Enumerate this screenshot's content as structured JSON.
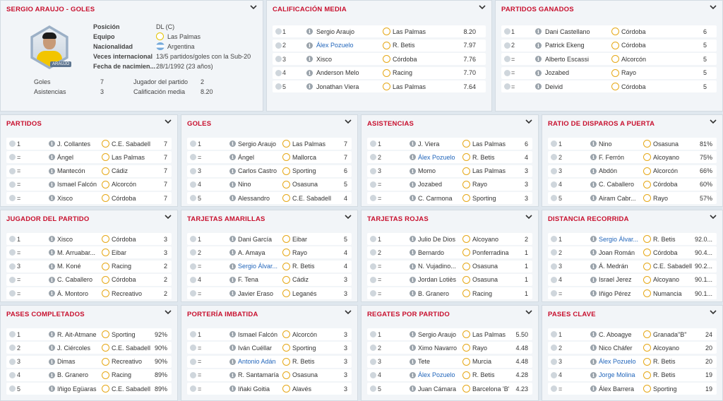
{
  "profile": {
    "title": "SERGIO ARAUJO - GOLES",
    "avatar_tag": "ARAUJO",
    "fields": [
      {
        "label": "Posición",
        "value": "DL (C)"
      },
      {
        "label": "Equipo",
        "value": "Las Palmas"
      },
      {
        "label": "Nacionalidad",
        "value": "Argentina"
      },
      {
        "label": "Veces internacional",
        "value": "13/5 partidos/goles con la Sub-20"
      },
      {
        "label": "Fecha de nacimien...",
        "value": "28/1/1992 (23 años)"
      }
    ],
    "stats": [
      {
        "label": "Goles",
        "value": "7"
      },
      {
        "label": "Asistencias",
        "value": "3"
      },
      {
        "label": "Jugador del partido",
        "value": "2"
      },
      {
        "label": "Calificación media",
        "value": "8.20"
      }
    ]
  },
  "calificacion": {
    "title": "CALIFICACIÓN MEDIA",
    "rows": [
      {
        "pos": "1",
        "name": "Sergio Araujo",
        "club": "Las Palmas",
        "value": "8.20",
        "hl": false
      },
      {
        "pos": "2",
        "name": "Álex Pozuelo",
        "club": "R. Betis",
        "value": "7.97",
        "hl": true
      },
      {
        "pos": "3",
        "name": "Xisco",
        "club": "Córdoba",
        "value": "7.76",
        "hl": false
      },
      {
        "pos": "4",
        "name": "Anderson Melo",
        "club": "Racing",
        "value": "7.70",
        "hl": false
      },
      {
        "pos": "5",
        "name": "Jonathan Viera",
        "club": "Las Palmas",
        "value": "7.64",
        "hl": false
      }
    ]
  },
  "ganados": {
    "title": "PARTIDOS GANADOS",
    "rows": [
      {
        "pos": "1",
        "name": "Dani Castellano",
        "club": "Córdoba",
        "value": "6",
        "hl": false
      },
      {
        "pos": "2",
        "name": "Patrick Ekeng",
        "club": "Córdoba",
        "value": "5",
        "hl": false
      },
      {
        "pos": "=",
        "name": "Alberto Escassi",
        "club": "Alcorcón",
        "value": "5",
        "hl": false
      },
      {
        "pos": "=",
        "name": "Jozabed",
        "club": "Rayo",
        "value": "5",
        "hl": false
      },
      {
        "pos": "=",
        "name": "Deivid",
        "club": "Córdoba",
        "value": "5",
        "hl": false
      }
    ]
  },
  "grid": [
    {
      "title": "PARTIDOS",
      "rows": [
        {
          "pos": "1",
          "name": "J. Collantes",
          "club": "C.E. Sabadell",
          "value": "7",
          "hl": false
        },
        {
          "pos": "=",
          "name": "Ángel",
          "club": "Las Palmas",
          "value": "7",
          "hl": false
        },
        {
          "pos": "=",
          "name": "Mantecón",
          "club": "Cádiz",
          "value": "7",
          "hl": false
        },
        {
          "pos": "=",
          "name": "Ismael Falcón",
          "club": "Alcorcón",
          "value": "7",
          "hl": false
        },
        {
          "pos": "=",
          "name": "Xisco",
          "club": "Córdoba",
          "value": "7",
          "hl": false
        }
      ]
    },
    {
      "title": "GOLES",
      "rows": [
        {
          "pos": "1",
          "name": "Sergio Araujo",
          "club": "Las Palmas",
          "value": "7",
          "hl": false
        },
        {
          "pos": "=",
          "name": "Ángel",
          "club": "Mallorca",
          "value": "7",
          "hl": false
        },
        {
          "pos": "3",
          "name": "Carlos Castro",
          "club": "Sporting",
          "value": "6",
          "hl": false
        },
        {
          "pos": "4",
          "name": "Nino",
          "club": "Osasuna",
          "value": "5",
          "hl": false
        },
        {
          "pos": "5",
          "name": "Alessandro",
          "club": "C.E. Sabadell",
          "value": "4",
          "hl": false
        }
      ]
    },
    {
      "title": "ASISTENCIAS",
      "rows": [
        {
          "pos": "1",
          "name": "J. Viera",
          "club": "Las Palmas",
          "value": "6",
          "hl": false
        },
        {
          "pos": "2",
          "name": "Álex Pozuelo",
          "club": "R. Betis",
          "value": "4",
          "hl": true
        },
        {
          "pos": "3",
          "name": "Momo",
          "club": "Las Palmas",
          "value": "3",
          "hl": false
        },
        {
          "pos": "=",
          "name": "Jozabed",
          "club": "Rayo",
          "value": "3",
          "hl": false
        },
        {
          "pos": "=",
          "name": "C. Carmona",
          "club": "Sporting",
          "value": "3",
          "hl": false
        }
      ]
    },
    {
      "title": "RATIO DE DISPAROS A PUERTA",
      "rows": [
        {
          "pos": "1",
          "name": "Nino",
          "club": "Osasuna",
          "value": "81%",
          "hl": false
        },
        {
          "pos": "2",
          "name": "F. Ferrón",
          "club": "Alcoyano",
          "value": "75%",
          "hl": false
        },
        {
          "pos": "3",
          "name": "Abdón",
          "club": "Alcorcón",
          "value": "66%",
          "hl": false
        },
        {
          "pos": "4",
          "name": "C. Caballero",
          "club": "Córdoba",
          "value": "60%",
          "hl": false
        },
        {
          "pos": "5",
          "name": "Airam Cabr...",
          "club": "Rayo",
          "value": "57%",
          "hl": false
        }
      ]
    },
    {
      "title": "JUGADOR DEL PARTIDO",
      "rows": [
        {
          "pos": "1",
          "name": "Xisco",
          "club": "Córdoba",
          "value": "3",
          "hl": false
        },
        {
          "pos": "=",
          "name": "M. Arruabar...",
          "club": "Eibar",
          "value": "3",
          "hl": false
        },
        {
          "pos": "3",
          "name": "M. Koné",
          "club": "Racing",
          "value": "2",
          "hl": false
        },
        {
          "pos": "=",
          "name": "C. Caballero",
          "club": "Córdoba",
          "value": "2",
          "hl": false
        },
        {
          "pos": "=",
          "name": "Á. Montoro",
          "club": "Recreativo",
          "value": "2",
          "hl": false
        }
      ]
    },
    {
      "title": "TARJETAS AMARILLAS",
      "rows": [
        {
          "pos": "1",
          "name": "Dani García",
          "club": "Eibar",
          "value": "5",
          "hl": false
        },
        {
          "pos": "2",
          "name": "A. Amaya",
          "club": "Rayo",
          "value": "4",
          "hl": false
        },
        {
          "pos": "=",
          "name": "Sergio Álvar...",
          "club": "R. Betis",
          "value": "4",
          "hl": true
        },
        {
          "pos": "4",
          "name": "F. Tena",
          "club": "Cádiz",
          "value": "3",
          "hl": false
        },
        {
          "pos": "=",
          "name": "Javier Eraso",
          "club": "Leganés",
          "value": "3",
          "hl": false
        }
      ]
    },
    {
      "title": "TARJETAS ROJAS",
      "rows": [
        {
          "pos": "1",
          "name": "Julio De Dios",
          "club": "Alcoyano",
          "value": "2",
          "hl": false
        },
        {
          "pos": "2",
          "name": "Bernardo",
          "club": "Ponferradina",
          "value": "1",
          "hl": false
        },
        {
          "pos": "=",
          "name": "N. Vujadino...",
          "club": "Osasuna",
          "value": "1",
          "hl": false
        },
        {
          "pos": "=",
          "name": "Jordan Lotiès",
          "club": "Osasuna",
          "value": "1",
          "hl": false
        },
        {
          "pos": "=",
          "name": "B. Granero",
          "club": "Racing",
          "value": "1",
          "hl": false
        }
      ]
    },
    {
      "title": "DISTANCIA RECORRIDA",
      "rows": [
        {
          "pos": "1",
          "name": "Sergio Álvar...",
          "club": "R. Betis",
          "value": "92.0...",
          "hl": true
        },
        {
          "pos": "2",
          "name": "Joan Román",
          "club": "Córdoba",
          "value": "90.4...",
          "hl": false
        },
        {
          "pos": "3",
          "name": "Á. Medrán",
          "club": "C.E. Sabadell",
          "value": "90.2...",
          "hl": false
        },
        {
          "pos": "4",
          "name": "Israel Jerez",
          "club": "Alcoyano",
          "value": "90.1...",
          "hl": false
        },
        {
          "pos": "=",
          "name": "Iñigo Pérez",
          "club": "Numancia",
          "value": "90.1...",
          "hl": false
        }
      ]
    },
    {
      "title": "PASES COMPLETADOS",
      "rows": [
        {
          "pos": "1",
          "name": "R. Ait-Atmane",
          "club": "Sporting",
          "value": "92%",
          "hl": false
        },
        {
          "pos": "2",
          "name": "J. Ciércoles",
          "club": "C.E. Sabadell",
          "value": "90%",
          "hl": false
        },
        {
          "pos": "3",
          "name": "Dimas",
          "club": "Recreativo",
          "value": "90%",
          "hl": false
        },
        {
          "pos": "4",
          "name": "B. Granero",
          "club": "Racing",
          "value": "89%",
          "hl": false
        },
        {
          "pos": "5",
          "name": "Iñigo Egüaras",
          "club": "C.E. Sabadell",
          "value": "89%",
          "hl": false
        }
      ]
    },
    {
      "title": "PORTERÍA IMBATIDA",
      "rows": [
        {
          "pos": "1",
          "name": "Ismael Falcón",
          "club": "Alcorcón",
          "value": "3",
          "hl": false
        },
        {
          "pos": "=",
          "name": "Iván Cuéllar",
          "club": "Sporting",
          "value": "3",
          "hl": false
        },
        {
          "pos": "=",
          "name": "Antonio Adán",
          "club": "R. Betis",
          "value": "3",
          "hl": true
        },
        {
          "pos": "=",
          "name": "R. Santamaría",
          "club": "Osasuna",
          "value": "3",
          "hl": false
        },
        {
          "pos": "=",
          "name": "Iñaki Goitia",
          "club": "Alavés",
          "value": "3",
          "hl": false
        }
      ]
    },
    {
      "title": "REGATES POR PARTIDO",
      "rows": [
        {
          "pos": "1",
          "name": "Sergio Araujo",
          "club": "Las Palmas",
          "value": "5.50",
          "hl": false
        },
        {
          "pos": "2",
          "name": "Ximo Navarro",
          "club": "Rayo",
          "value": "4.48",
          "hl": false
        },
        {
          "pos": "3",
          "name": "Tete",
          "club": "Murcia",
          "value": "4.48",
          "hl": false
        },
        {
          "pos": "4",
          "name": "Álex Pozuelo",
          "club": "R. Betis",
          "value": "4.28",
          "hl": true
        },
        {
          "pos": "5",
          "name": "Juan Cámara",
          "club": "Barcelona 'B'",
          "value": "4.23",
          "hl": false
        }
      ]
    },
    {
      "title": "PASES CLAVE",
      "rows": [
        {
          "pos": "1",
          "name": "C. Aboagye",
          "club": "Granada\"B\"",
          "value": "24",
          "hl": false
        },
        {
          "pos": "2",
          "name": "Nico Cháfer",
          "club": "Alcoyano",
          "value": "20",
          "hl": false
        },
        {
          "pos": "3",
          "name": "Álex Pozuelo",
          "club": "R. Betis",
          "value": "20",
          "hl": true
        },
        {
          "pos": "4",
          "name": "Jorge Molina",
          "club": "R. Betis",
          "value": "19",
          "hl": true
        },
        {
          "pos": "=",
          "name": "Álex Barrera",
          "club": "Sporting",
          "value": "19",
          "hl": false
        }
      ]
    }
  ]
}
